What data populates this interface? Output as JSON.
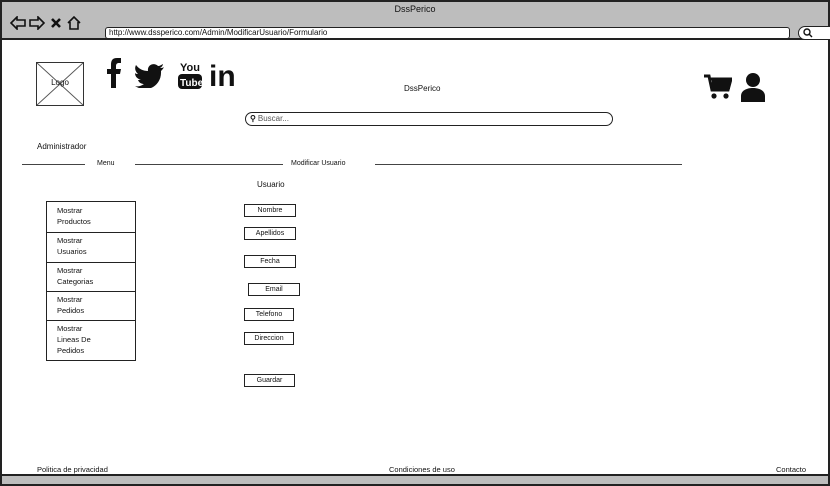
{
  "window": {
    "title": "DssPerico"
  },
  "browser": {
    "url": "http://www.dssperico.com/Admin/ModificarUsuario/Formulario"
  },
  "header": {
    "logo_text": "Logo",
    "brand": "DssPerico"
  },
  "search": {
    "placeholder": "Buscar..."
  },
  "admin_label": "Administrador",
  "section_menu": "Menu",
  "section_title": "Modificar Usuario",
  "form_heading": "Usuario",
  "menu": {
    "items": [
      {
        "line1": "Mostrar",
        "line2": "Productos"
      },
      {
        "line1": "Mostrar",
        "line2": "Usuarios"
      },
      {
        "line1": "Mostrar",
        "line2": "Categorias"
      },
      {
        "line1": "Mostrar",
        "line2": "Pedidos"
      },
      {
        "line1": "Mostrar",
        "line2": "Lineas De",
        "line3": "Pedidos"
      }
    ]
  },
  "form": {
    "nombre": "Nombre",
    "apellidos": "Apellidos",
    "fecha": "Fecha",
    "email": "Email",
    "telefono": "Telefono",
    "direccion": "Direccion",
    "guardar": "Guardar"
  },
  "footer": {
    "privacy": "Politica de privacidad",
    "terms": "Condiciones de uso",
    "contact": "Contacto"
  },
  "colors": {
    "chrome": "#bdbdbd",
    "ink": "#111111"
  },
  "icons": [
    "back-arrow-icon",
    "forward-arrow-icon",
    "close-icon",
    "home-icon",
    "search-icon",
    "facebook-icon",
    "twitter-icon",
    "youtube-icon",
    "linkedin-icon",
    "cart-icon",
    "user-icon"
  ]
}
